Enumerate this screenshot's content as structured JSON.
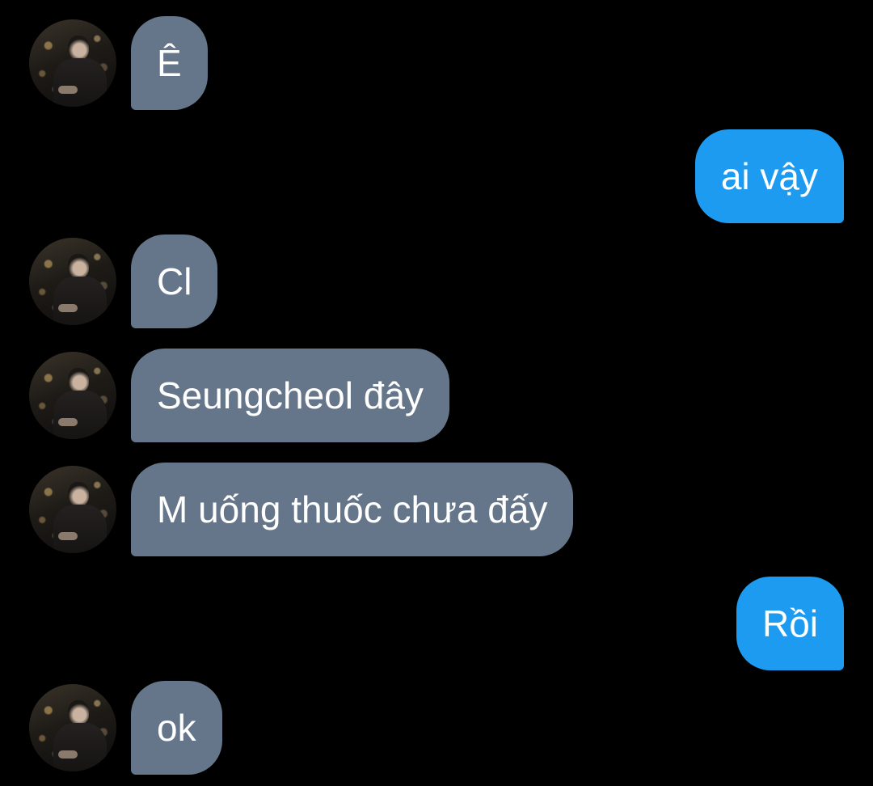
{
  "conversation": {
    "colors": {
      "background": "#000000",
      "received_bubble": "#66768a",
      "sent_bubble": "#1d9bf0",
      "text": "#ffffff"
    },
    "messages": [
      {
        "direction": "received",
        "text": "Ê",
        "avatar": "contact-avatar"
      },
      {
        "direction": "sent",
        "text": "ai vậy"
      },
      {
        "direction": "received",
        "text": "Cl",
        "avatar": "contact-avatar"
      },
      {
        "direction": "received",
        "text": "Seungcheol đây",
        "avatar": "contact-avatar"
      },
      {
        "direction": "received",
        "text": "M uống thuốc chưa đấy",
        "avatar": "contact-avatar"
      },
      {
        "direction": "sent",
        "text": "Rồi"
      },
      {
        "direction": "received",
        "text": "ok",
        "avatar": "contact-avatar"
      }
    ]
  }
}
